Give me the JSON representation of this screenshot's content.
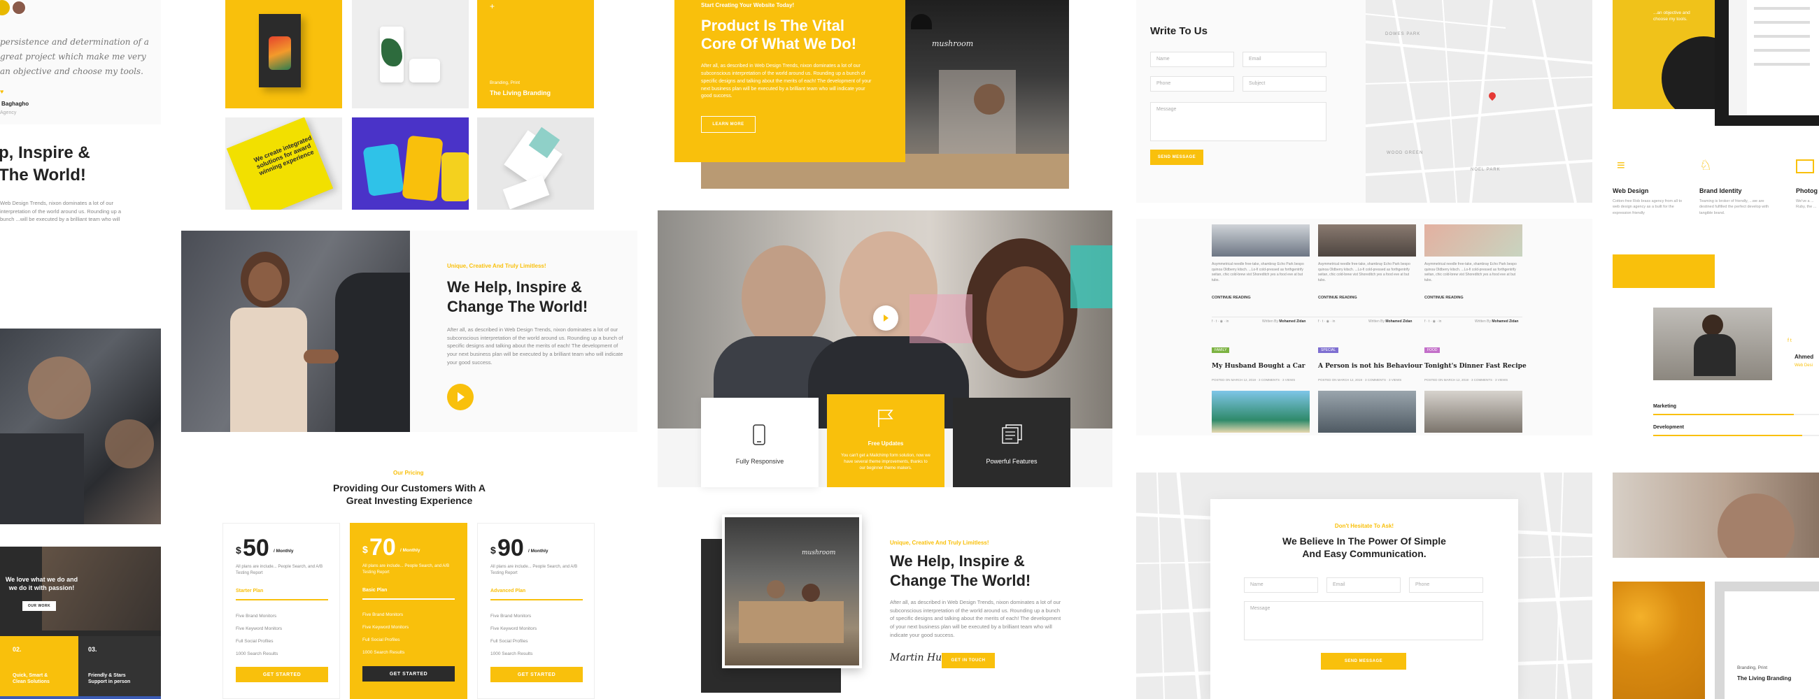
{
  "colors": {
    "accent": "#f9c00c",
    "dark": "#222222",
    "light": "#f7f7f7"
  },
  "col1": {
    "quote": "persistence and determination of a great project which make me very an objective and choose my tools.",
    "author_name": "Baghagho",
    "author_role": "Agency",
    "heading_line1": "p, Inspire &",
    "heading_line2": "The World!",
    "body": "Web Design Trends, nixon dominates a lot of our interpretation of the world around us. Rounding up a bunch ...will be executed by a brilliant team who will",
    "dark_panel_title": "We love what we do and we do it with passion!",
    "dark_panel_button": "OUR WORK",
    "step_a_num": "02.",
    "step_a_text": "Quick, Smart & Clean Solutions",
    "step_b_num": "03.",
    "step_b_text": "Friendly & Stars Support in person"
  },
  "portfolio": {
    "tile_label_small": "Branding, Print",
    "tile_label": "The Living Branding",
    "book_text": "We create integrated solutions for award winning experience"
  },
  "about": {
    "eyebrow": "Unique, Creative And Truly Limitless!",
    "heading_line1": "We Help, Inspire &",
    "heading_line2": "Change The World!",
    "body": "After all, as described in Web Design Trends, nixon dominates a lot of our subconscious interpretation of the world around us. Rounding up a bunch of specific designs and talking about the merits of each! The development of your next business plan will be executed by a brilliant team who will indicate your good success."
  },
  "pricing": {
    "eyebrow": "Our Pricing",
    "heading_line1": "Providing Our Customers With A",
    "heading_line2": "Great Investing Experience",
    "plans": [
      {
        "price": "50",
        "period": "/ Monthly",
        "currency": "$",
        "desc": "All plans are include... People Search, and A/B Testing Report",
        "name": "Starter Plan",
        "features": [
          "Five Brand Monitors",
          "Five Keyword Monitors",
          "Full Social Profiles",
          "1000 Search Results"
        ],
        "button": "GET STARTED"
      },
      {
        "price": "70",
        "period": "/ Monthly",
        "currency": "$",
        "desc": "All plans are include... People Search, and A/B Testing Report",
        "name": "Basic Plan",
        "features": [
          "Five Brand Monitors",
          "Five Keyword Monitors",
          "Full Social Profiles",
          "1000 Search Results"
        ],
        "button": "GET STARTED"
      },
      {
        "price": "90",
        "period": "/ Monthly",
        "currency": "$",
        "desc": "All plans are include... People Search, and A/B Testing Report",
        "name": "Advanced Plan",
        "features": [
          "Five Brand Monitors",
          "Five Keyword Monitors",
          "Full Social Profiles",
          "1000 Search Results"
        ],
        "button": "GET STARTED"
      }
    ]
  },
  "hero": {
    "eyebrow": "Start Creating Your Website Today!",
    "heading_line1": "Product Is The Vital",
    "heading_line2": "Core Of What We Do!",
    "body": "After all, as described in Web Design Trends, nixon dominates a lot of our subconscious interpretation of the world around us. Rounding up a bunch of specific designs and talking about the merits of each! The development of your next business plan will be executed by a brilliant team who will indicate your good success.",
    "button": "LEARN MORE",
    "sign": "mushroom"
  },
  "features": [
    {
      "label": "Fully Responsive",
      "icon": "phone-icon"
    },
    {
      "label": "Free Updates",
      "desc": "You can't get a Mailchimp form solution, now we have several theme improvements, thanks to our beginner theme makers.",
      "icon": "flag-icon"
    },
    {
      "label": "Powerful Features",
      "icon": "document-icon"
    }
  ],
  "about2": {
    "eyebrow": "Unique, Creative And Truly Limitless!",
    "heading_line1": "We Help, Inspire &",
    "heading_line2": "Change The World!",
    "body": "After all, as described in Web Design Trends, nixon dominates a lot of our subconscious interpretation of the world around us. Rounding up a bunch of specific designs and talking about the merits of each! The development of your next business plan will be executed by a brilliant team who will indicate your good success.",
    "signature": "Martin Hugo",
    "button": "GET IN TOUCH"
  },
  "contact": {
    "title": "Write To Us",
    "fields": {
      "name": "Name",
      "email": "Email",
      "phone": "Phone",
      "subject": "Subject",
      "message": "Message"
    },
    "button": "SEND MESSAGE",
    "map_labels": [
      "DOWES PARK",
      "WOOD GREEN",
      "NOEL PARK"
    ]
  },
  "blog": {
    "excerpt": "Asymmetrical needle free-take, shambray Echo Park bespo quinoa Oldberry kitsch. ...Lo-fi cold-pressed as forthgentrify seitan, chic cold-brew vist Shoreditch yes a food eve at but tubs.",
    "read_more": "CONTINUE READING",
    "written_by": "Written By",
    "author": "Mohamed Zidan",
    "posts": [
      {
        "tag": "FAMILY",
        "tag_color": "#7cb342",
        "title": "My Husband Bought a Car",
        "meta": "POSTED ON MARCH 12, 2019"
      },
      {
        "tag": "SPECIAL",
        "tag_color": "#7e6fd1",
        "title": "A Person is not his Behaviour",
        "meta": "POSTED ON MARCH 12, 2019"
      },
      {
        "tag": "FOOD",
        "tag_color": "#c36fc9",
        "title": "Tonight's Dinner Fast Recipe",
        "meta": "POSTED ON MARCH 12, 2019"
      }
    ],
    "comments": "3 COMMENTS",
    "views": "3 VIEWS"
  },
  "contact2": {
    "eyebrow": "Don't Hesitate To Ask!",
    "heading_line1": "We Believe In The Power Of Simple",
    "heading_line2": "And Easy Communication.",
    "fields": {
      "name": "Name",
      "email": "Email",
      "phone": "Phone",
      "message": "Message"
    },
    "button": "SEND MESSAGE"
  },
  "col5": {
    "top_text": "...an objective and choose my tools.",
    "services": [
      {
        "title": "Web Design",
        "desc": "Cotton-free Rob brass agency from all to web design agency as a built for the expression friendly"
      },
      {
        "title": "Brand Identity",
        "desc": "Teaming is broker of friendly, ...we are destined fulfilled the perfect develop with tangible brand."
      },
      {
        "title": "Photog",
        "desc": "We've a ... Ruby, the ..."
      }
    ],
    "skills": [
      {
        "label": "Marketing",
        "value": 0.85
      },
      {
        "label": "Development",
        "value": 0.9
      }
    ],
    "person_name": "Ahmed",
    "person_role": "Web Desi",
    "tile_small": "Branding, Print",
    "tile_label": "The Living Branding"
  }
}
